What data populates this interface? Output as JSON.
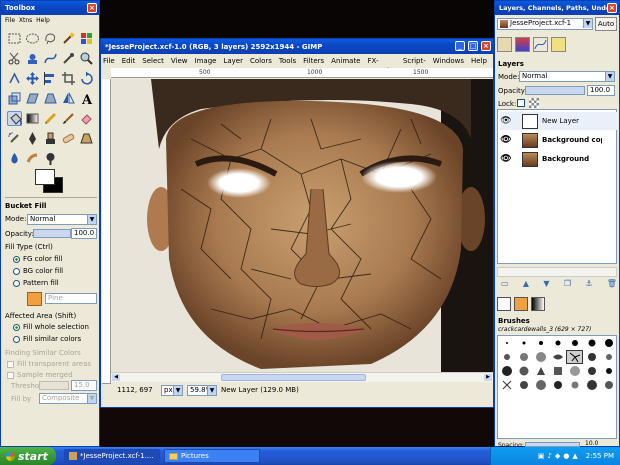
{
  "toolbox": {
    "title": "Toolbox",
    "tool_options_title": "Bucket Fill",
    "mode_label": "Mode:",
    "mode_value": "Normal",
    "opacity_label": "Opacity:",
    "opacity_value": "100.0",
    "fill_type_label": "Fill Type  (Ctrl)",
    "fill_types": [
      "FG color fill",
      "BG color fill",
      "Pattern fill"
    ],
    "pattern_name": "Pine",
    "affected_area_label": "Affected Area  (Shift)",
    "affected_options": [
      "Fill whole selection",
      "Fill similar colors"
    ],
    "finding_label": "Finding Similar Colors",
    "fill_transparent": "Fill transparent areas",
    "sample_merged": "Sample merged",
    "threshold_label": "Threshold",
    "threshold_value": "15.0",
    "fill_by_label": "Fill by",
    "fill_by_value": "Composite"
  },
  "image_window": {
    "title": "*JesseProject.xcf-1.0 (RGB, 3 layers) 2592x1944 - GIMP",
    "menus": [
      "File",
      "Edit",
      "Select",
      "View",
      "Image",
      "Layer",
      "Colors",
      "Tools",
      "Filters",
      "Animate",
      "FX-Foundry",
      "Script-Fu",
      "Windows",
      "Help"
    ],
    "ruler_marks": [
      "500",
      "1000",
      "1500"
    ],
    "coords": "1112, 697",
    "unit": "px",
    "zoom": "59.8%",
    "status": "New Layer (129.0 MB)"
  },
  "dock": {
    "title": "Layers, Channels, Paths, Undo -",
    "image_selector": "JesseProject.xcf-1",
    "auto_label": "Auto",
    "layers_title": "Layers",
    "mode_label": "Mode:",
    "mode_value": "Normal",
    "opacity_label": "Opacity:",
    "opacity_value": "100.0",
    "lock_label": "Lock:",
    "layers": [
      "New Layer",
      "Background copy",
      "Background"
    ],
    "brushes_title": "Brushes",
    "brush_name": "crackcardewalls_3 (629 × 727)",
    "spacing_label": "Spacing:",
    "spacing_value": "10.0"
  },
  "taskbar": {
    "start_label": "start",
    "tasks": [
      "*JesseProject.xcf-1....",
      "Pictures"
    ],
    "clock": "2:55 PM"
  },
  "colors": {
    "xp_blue": "#0a47c4",
    "start_green": "#3a9a35",
    "panel": "#ece9d8"
  }
}
